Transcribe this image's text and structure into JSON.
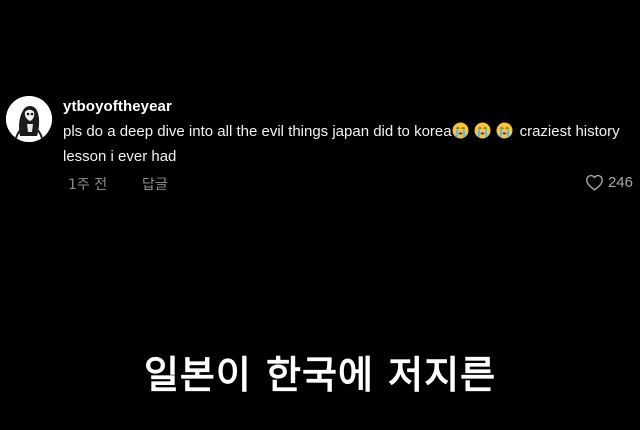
{
  "comment": {
    "username": "ytboyoftheyear",
    "text_before_emoji": "pls do a deep dive into all the evil things japan did to korea",
    "emoji": [
      "loudly-crying-face",
      "loudly-crying-face",
      "loudly-crying-face"
    ],
    "text_after_emoji": "craziest history lesson i ever had",
    "timestamp": "1주 전",
    "reply_label": "답글",
    "like_icon": "heart-outline-icon",
    "like_count": "246"
  },
  "subtitle": {
    "text": "일본이 한국에 저지른"
  },
  "colors": {
    "background": "#000000",
    "text_primary": "#ffffff",
    "text_secondary": "#8a8a8a"
  }
}
